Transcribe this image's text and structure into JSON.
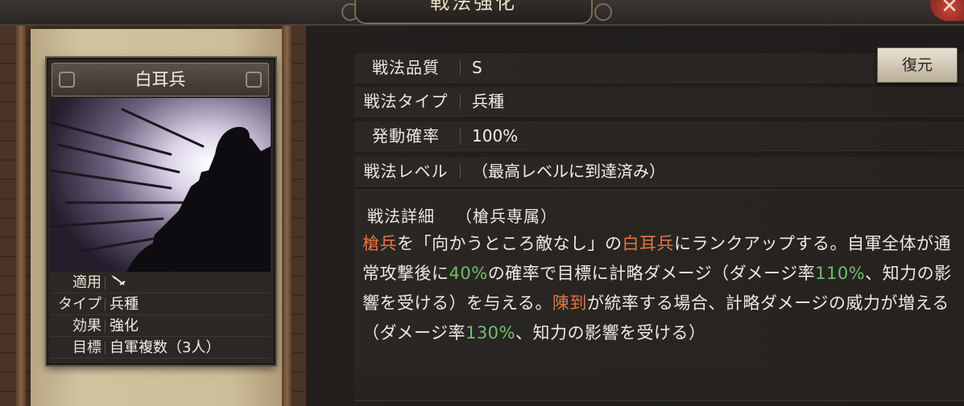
{
  "window": {
    "title": "戦法強化",
    "close_label": "✕"
  },
  "card": {
    "name": "白耳兵",
    "info": [
      {
        "key": "適用",
        "value": ""
      },
      {
        "key": "タイプ",
        "value": "兵種"
      },
      {
        "key": "効果",
        "value": "強化"
      },
      {
        "key": "目標",
        "value": "自軍複数（3人）"
      }
    ]
  },
  "stats": [
    {
      "key": "戦法品質",
      "value": "S"
    },
    {
      "key": "戦法タイプ",
      "value": "兵種"
    },
    {
      "key": "発動確率",
      "value": "100%"
    },
    {
      "key": "戦法レベル",
      "value": "（最高レベルに到達済み）"
    }
  ],
  "restore_button": "復元",
  "detail": {
    "heading": "戦法詳細",
    "subheading": "（槍兵専属）",
    "segments": [
      {
        "t": "槍兵",
        "c": "o"
      },
      {
        "t": "を「向かうところ敵なし」の",
        "c": ""
      },
      {
        "t": "白耳兵",
        "c": "o"
      },
      {
        "t": "にランクアップする。自軍全体が通常攻撃後に",
        "c": ""
      },
      {
        "t": "40%",
        "c": "g"
      },
      {
        "t": "の確率で目標に計略ダメージ（ダメージ率",
        "c": ""
      },
      {
        "t": "110%",
        "c": "g"
      },
      {
        "t": "、知力の影響を受ける）を与える。",
        "c": ""
      },
      {
        "t": "陳到",
        "c": "o"
      },
      {
        "t": "が統率する場合、計略ダメージの威力が増える（ダメージ率",
        "c": ""
      },
      {
        "t": "130%",
        "c": "g"
      },
      {
        "t": "、知力の影響を受ける）",
        "c": ""
      }
    ]
  },
  "colors": {
    "highlight_orange": "#e0773f",
    "highlight_green": "#6fbf6a",
    "close_red": "#c6463a"
  }
}
